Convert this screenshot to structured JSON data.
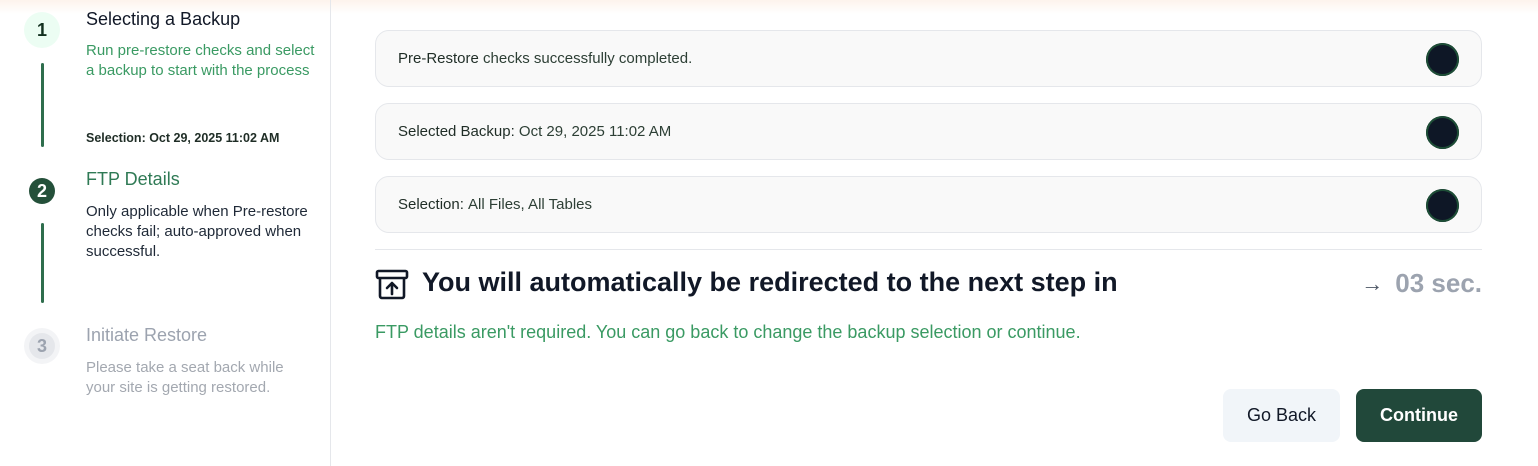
{
  "steps": [
    {
      "number": "1",
      "title": "Selecting a Backup",
      "description": "Run pre-restore checks and select a backup to start with the process",
      "selection": "Selection: Oct 29, 2025 11:02 AM"
    },
    {
      "number": "2",
      "title": "FTP Details",
      "description": "Only applicable when Pre-restore checks fail; auto-approved when successful."
    },
    {
      "number": "3",
      "title": "Initiate Restore",
      "description": "Please take a seat back while your site is getting restored."
    }
  ],
  "status_cards": [
    {
      "label": "Pre-Restore",
      "text": "checks successfully completed."
    },
    {
      "label": "Selected Backup:",
      "text": "Oct 29, 2025 11:02 AM"
    },
    {
      "label": "Selection:",
      "text": "All Files, All Tables"
    }
  ],
  "redirect": {
    "icon": "archive-upload-icon",
    "message": "You will automatically be redirected to the next step in",
    "arrow": "→",
    "countdown": "03 sec."
  },
  "note": "FTP details aren't required. You can go back to change the backup selection or continue.",
  "buttons": {
    "back": "Go Back",
    "continue": "Continue"
  },
  "colors": {
    "accent_green": "#24503a",
    "note_green": "#3a9a63",
    "continue_bg": "#21483a",
    "status_dot": "#0e1726"
  }
}
